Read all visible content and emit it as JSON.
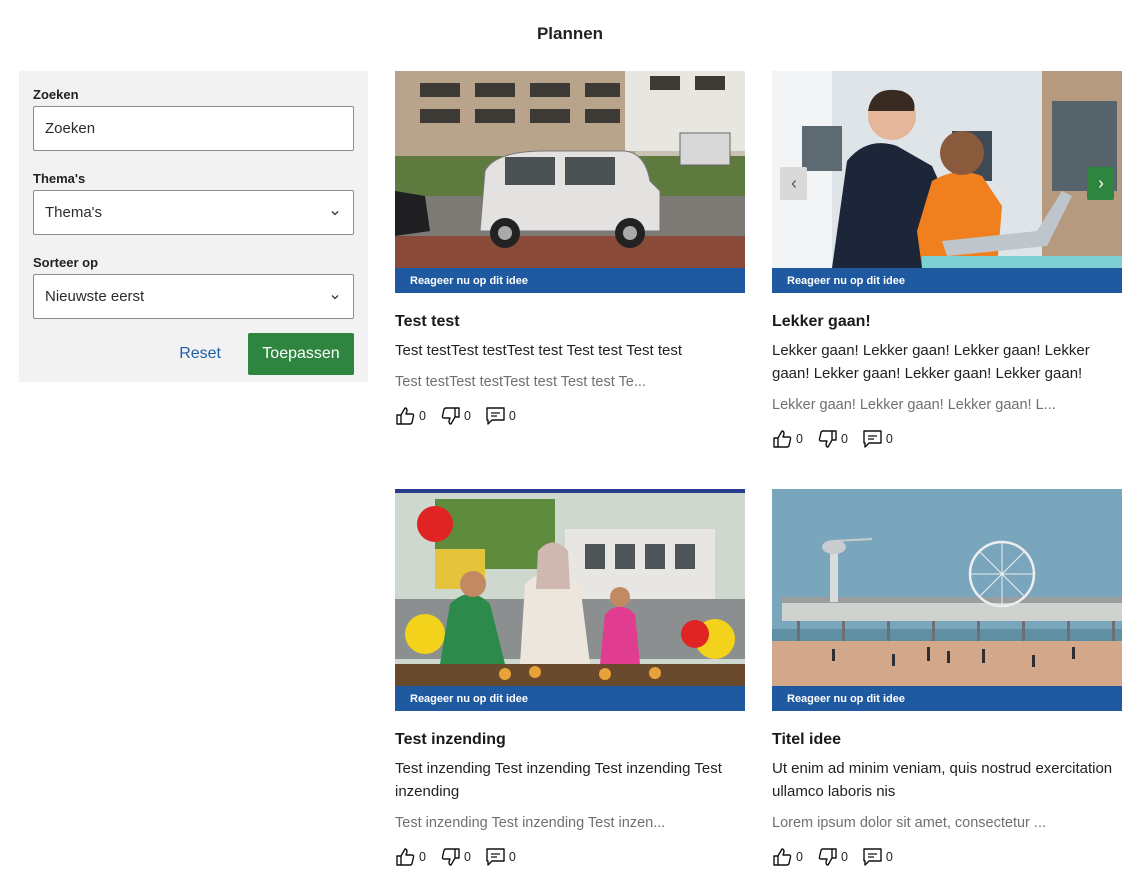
{
  "page": {
    "title": "Plannen"
  },
  "filters": {
    "search_label": "Zoeken",
    "search_placeholder": "Zoeken",
    "themes_label": "Thema's",
    "themes_value": "Thema's",
    "sort_label": "Sorteer op",
    "sort_value": "Nieuwste eerst",
    "reset_label": "Reset",
    "apply_label": "Toepassen"
  },
  "cards": [
    {
      "banner": "Reageer nu op dit idee",
      "title": "Test test",
      "description": "Test testTest testTest test Test test Test test",
      "excerpt": "Test testTest testTest test Test test Te...",
      "likes": "0",
      "dislikes": "0",
      "comments": "0"
    },
    {
      "banner": "Reageer nu op dit idee",
      "title": "Lekker gaan!",
      "description": "Lekker gaan! Lekker gaan! Lekker gaan! Lekker gaan! Lekker gaan! Lekker gaan! Lekker gaan!",
      "excerpt": "Lekker gaan! Lekker gaan! Lekker gaan! L...",
      "likes": "0",
      "dislikes": "0",
      "comments": "0",
      "prev_icon": "chevron-left-icon",
      "next_icon": "chevron-right-icon"
    },
    {
      "banner": "Reageer nu op dit idee",
      "title": "Test inzending",
      "description": "Test inzending Test inzending Test inzending Test inzending",
      "excerpt": "Test inzending Test inzending Test inzen...",
      "likes": "0",
      "dislikes": "0",
      "comments": "0"
    },
    {
      "banner": "Reageer nu op dit idee",
      "title": "Titel idee",
      "description": "Ut enim ad minim veniam, quis nostrud exercitation ullamco laboris nis",
      "excerpt": "Lorem ipsum dolor sit amet, consectetur ...",
      "likes": "0",
      "dislikes": "0",
      "comments": "0"
    }
  ],
  "colors": {
    "accent_green": "#2e8540",
    "banner_blue": "#1f5aa0",
    "link_blue": "#1f5faa",
    "panel_gray": "#f2f2f2"
  }
}
